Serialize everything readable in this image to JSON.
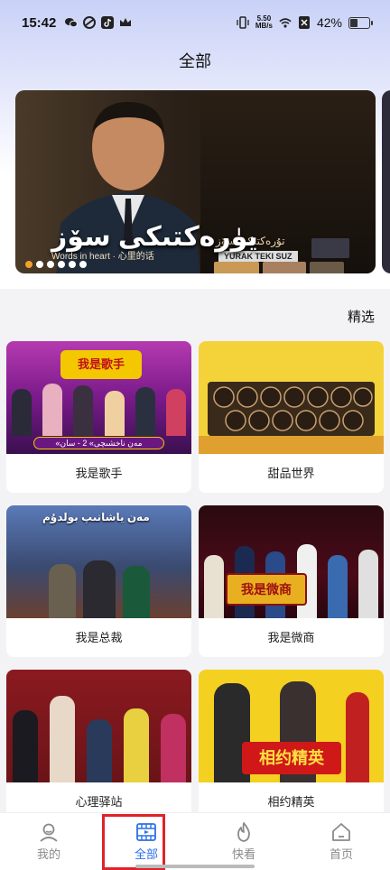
{
  "status_bar": {
    "time": "15:42",
    "speed_value": "5.50",
    "speed_unit": "MB/s",
    "battery": "42%"
  },
  "header": {
    "title": "全部"
  },
  "banner": {
    "title": "يۈرەكتىكى سۆز",
    "subtitle": "Words in heart · 心里的话",
    "album_label": "YURAK TEKI SUZ",
    "album_title": "تۇرەكتىكى سۆز",
    "dots": 6,
    "active_dot": 0
  },
  "section": {
    "label": "精选"
  },
  "cards": [
    {
      "label": "我是歌手",
      "overlay": "我是歌手",
      "overlay_sub": "مەن ناخشىچى",
      "caption": "«مەن ناخشىچى» 2 - سان"
    },
    {
      "label": "甜品世界"
    },
    {
      "label": "我是总裁",
      "overlay": "مەن ياشانىپ بولدۇم"
    },
    {
      "label": "我是微商",
      "overlay": "我是微商"
    },
    {
      "label": "心理驿站"
    },
    {
      "label": "相约精英",
      "overlay": "相约精英"
    }
  ],
  "tabs": [
    {
      "label": "我的",
      "icon": "user-icon",
      "active": false
    },
    {
      "label": "全部",
      "icon": "film-icon",
      "active": true
    },
    {
      "label": "快看",
      "icon": "flame-icon",
      "active": false
    },
    {
      "label": "首页",
      "icon": "home-icon",
      "active": false
    }
  ],
  "colors": {
    "accent": "#2c6fe8",
    "highlight": "#e0222a",
    "banner_dot_active": "#f0a030"
  }
}
